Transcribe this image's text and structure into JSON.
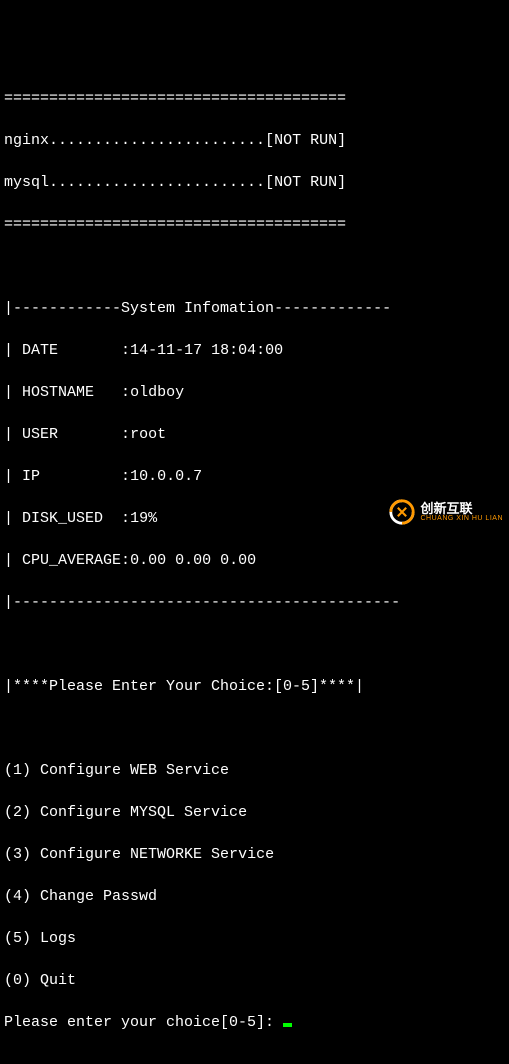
{
  "divider": "======================================",
  "services": [
    {
      "name": "nginx",
      "dots": "........................",
      "status": "[NOT RUN]"
    },
    {
      "name": "mysql",
      "dots": "........................",
      "status": "[NOT RUN]"
    }
  ],
  "sysinfo": {
    "title": "System Infomation",
    "left_dash": "|------------",
    "right_dash": "-------------",
    "rows": [
      {
        "label": "DATE",
        "pad": "       ",
        "value": "14-11-17 18:04:00"
      },
      {
        "label": "HOSTNAME",
        "pad": "   ",
        "value": "oldboy"
      },
      {
        "label": "USER",
        "pad": "       ",
        "value": "root"
      },
      {
        "label": "IP",
        "pad": "         ",
        "value": "10.0.0.7"
      },
      {
        "label": "DISK_USED",
        "pad": "  ",
        "value": "19%"
      },
      {
        "label": "CPU_AVERAGE",
        "pad": "",
        "value": "0.00 0.00 0.00"
      }
    ],
    "bottom_dash": "|-------------------------------------------"
  },
  "choice_header": "|****Please Enter Your Choice:[0-5]****|",
  "menu": [
    {
      "num": "(1)",
      "label": "Configure WEB Service"
    },
    {
      "num": "(2)",
      "label": "Configure MYSQL Service"
    },
    {
      "num": "(3)",
      "label": "Configure NETWORKE Service"
    },
    {
      "num": "(4)",
      "label": "Change Passwd"
    },
    {
      "num": "(5)",
      "label": "Logs"
    },
    {
      "num": "(0)",
      "label": "Quit"
    }
  ],
  "prompt": "Please enter your choice[0-5]: ",
  "watermark": {
    "cn": "创新互联",
    "en": "CHUANG XIN HU LIAN"
  }
}
